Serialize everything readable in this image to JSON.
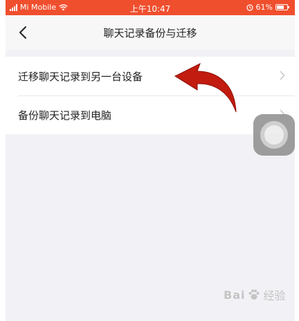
{
  "status_bar": {
    "carrier": "Mi Mobile",
    "time": "上午10:47",
    "battery_percent": "61%",
    "battery_level": 0.61,
    "icons": [
      "signal-icon",
      "wifi-icon",
      "alarm-icon",
      "battery-icon"
    ]
  },
  "nav": {
    "back_icon": "chevron-left-icon",
    "title": "聊天记录备份与迁移"
  },
  "menu": {
    "items": [
      {
        "label": "迁移聊天记录到另一台设备",
        "icon": "chevron-right-icon"
      },
      {
        "label": "备份聊天记录到电脑",
        "icon": "chevron-right-icon"
      }
    ]
  },
  "overlay": {
    "arrow_icon": "curved-arrow-icon",
    "arrow_color": "#c21b10",
    "assistive_touch_icon": "assistive-touch-icon"
  },
  "watermark": {
    "text": "Bai",
    "suffix": "经验",
    "icon": "paw-icon"
  },
  "colors": {
    "status_bar": "#f04f2e",
    "background": "#f2f2f6",
    "text": "#222222"
  }
}
